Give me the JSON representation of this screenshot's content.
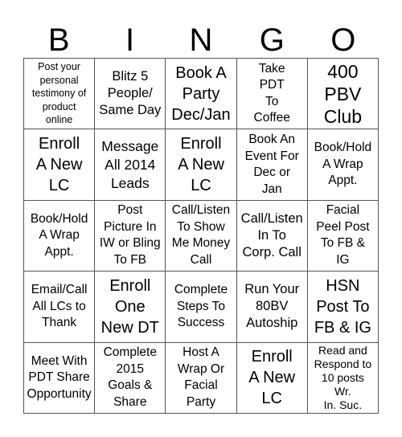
{
  "header": {
    "letters": [
      "B",
      "I",
      "N",
      "G",
      "O"
    ]
  },
  "cells": [
    [
      "Post your\npersonal\ntestimony of\nproduct\nonline",
      "Blitz 5\nPeople/\nSame Day",
      "Book A\nParty\nDec/Jan",
      "Take\nPDT\nTo\nCoffee",
      "400\nPBV\nClub"
    ],
    [
      "Enroll\nA New\nLC",
      "Message\nAll 2014\nLeads",
      "Enroll\nA New\nLC",
      "Book An\nEvent For\nDec or\nJan",
      "Book/Hold\nA Wrap\nAppt."
    ],
    [
      "Book/Hold\nA Wrap\nAppt.",
      "Post\nPicture In\nIW or Bling\nTo FB",
      "Call/Listen\nTo Show\nMe Money\nCall",
      "Call/Listen\nIn To\nCorp. Call",
      "Facial\nPeel Post\nTo FB &\nIG"
    ],
    [
      "Email/Call\nAll LCs to\nThank",
      "Enroll\nOne\nNew DT",
      "Complete\nSteps To\nSuccess",
      "Run Your\n80BV\nAutoship",
      "HSN\nPost To\nFB & IG"
    ],
    [
      "Meet With\nPDT Share\nOpportunity",
      "Complete\n2015\nGoals &\nShare",
      "Host A\nWrap Or\nFacial\nParty",
      "Enroll\nA New\nLC",
      "Read and\nRespond to\n10 posts\nWr.\nIn. Suc."
    ]
  ]
}
